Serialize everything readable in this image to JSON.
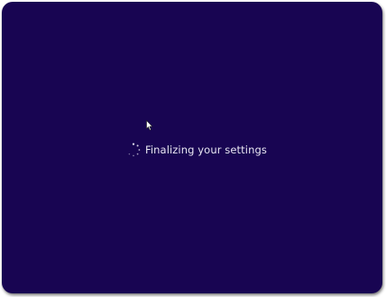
{
  "colors": {
    "background": "#180552",
    "text": "#e8e6f2"
  },
  "icons": {
    "spinner": "loading-spinner-icon",
    "cursor": "mouse-pointer-icon"
  },
  "status": {
    "message": "Finalizing your settings"
  }
}
